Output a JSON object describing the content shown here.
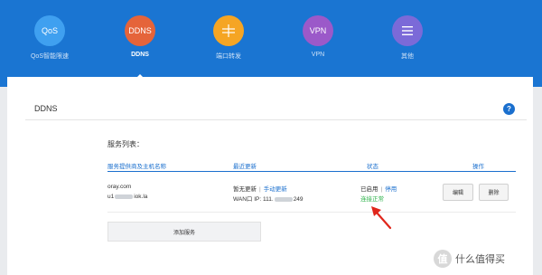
{
  "nav": {
    "items": [
      {
        "icon_text": "QoS",
        "label": "QoS智能限速",
        "color": "#3fa0f0",
        "icon": "qos-icon"
      },
      {
        "icon_text": "DDNS",
        "label": "DDNS",
        "color": "#e5643a",
        "icon": "ddns-icon"
      },
      {
        "icon_text": "",
        "label": "端口转发",
        "color": "#f5a524",
        "icon": "port-forward-icon"
      },
      {
        "icon_text": "VPN",
        "label": "VPN",
        "color": "#9b59c9",
        "icon": "vpn-icon"
      },
      {
        "icon_text": "",
        "label": "其他",
        "color": "#7b6ad8",
        "icon": "menu-icon"
      }
    ],
    "active": "DDNS"
  },
  "panel": {
    "title": "DDNS",
    "help": "?"
  },
  "services": {
    "section_title": "服务列表：",
    "columns": [
      "服务提供商及主机名称",
      "最近更新",
      "状态",
      "操作"
    ],
    "rows": [
      {
        "provider": "oray.com",
        "host_prefix": "u1",
        "host_suffix": "iok.la",
        "update_status": "暂无更新",
        "manual_update": "手动更新",
        "wan_ip_label": "WAN口 IP:",
        "wan_ip_prefix": "111.",
        "wan_ip_suffix": "249",
        "state": "已启用",
        "state_action": "停用",
        "connection": "连接正常",
        "edit_label": "编辑",
        "delete_label": "删除"
      }
    ],
    "add_button": "添加服务"
  },
  "watermark": {
    "logo": "值",
    "text": "什么值得买"
  }
}
